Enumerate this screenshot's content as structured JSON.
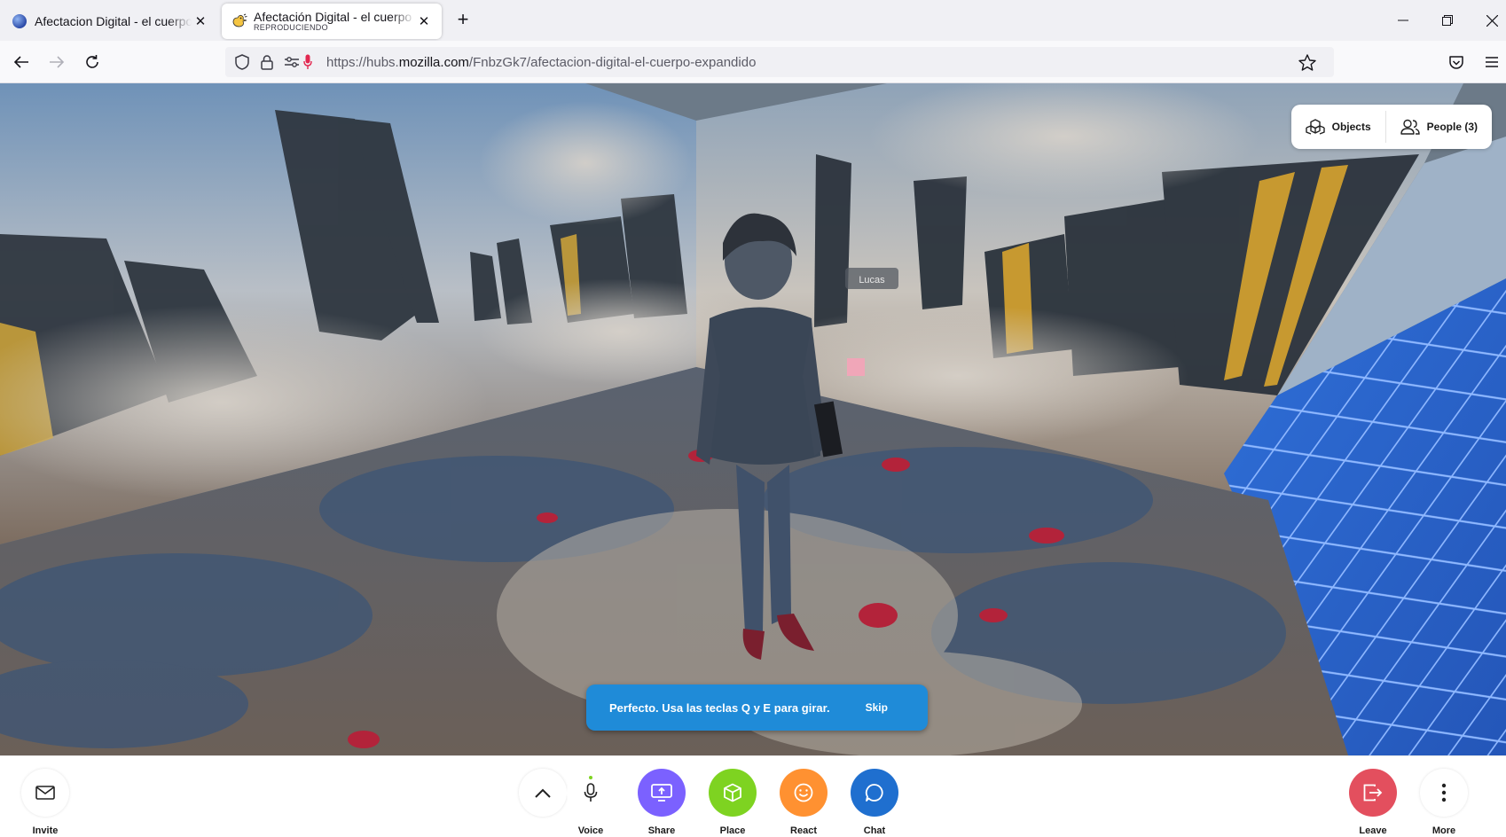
{
  "browser": {
    "tabs": [
      {
        "title": "Afectacion Digital - el cuerpo expandido",
        "subtitle": "",
        "active": false,
        "favicon": "globe-icon"
      },
      {
        "title": "Afectación Digital - el cuerpo expandido",
        "subtitle": "REPRODUCIENDO",
        "active": true,
        "favicon": "hubs-duck-icon"
      }
    ],
    "url": {
      "prefix": "https://hubs.",
      "domain": "mozilla.com",
      "path": "/FnbzGk7/afectacion-digital-el-cuerpo-expandido"
    }
  },
  "hubs": {
    "top_menu": {
      "objects_label": "Objects",
      "people_label": "People (3)"
    },
    "avatar_name_tag": "Lucas",
    "hint": {
      "message": "Perfecto. Usa las teclas Q y E para girar.",
      "skip_label": "Skip"
    },
    "toolbar": {
      "invite_label": "Invite",
      "voice_label": "Voice",
      "share_label": "Share",
      "place_label": "Place",
      "react_label": "React",
      "chat_label": "Chat",
      "leave_label": "Leave",
      "more_label": "More"
    },
    "colors": {
      "share": "#7b61ff",
      "place": "#7ed321",
      "react": "#ff9131",
      "chat": "#1f6fcf",
      "leave": "#e34f5e",
      "hint_bg": "#1f8bd8"
    }
  }
}
